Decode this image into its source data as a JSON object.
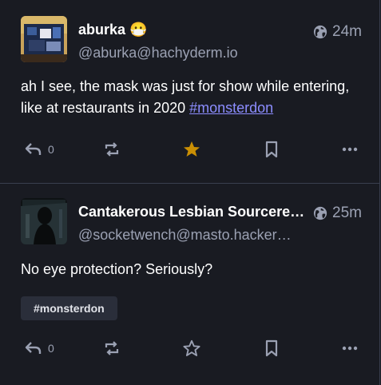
{
  "posts": [
    {
      "display_name": "aburka",
      "emoji": "😷",
      "handle": "@aburka@hachyderm.io",
      "time": "24m",
      "content_text": "ah I see, the mask was just for show while entering, like at restaurants in 2020 ",
      "hashtag": "#monsterdon",
      "reply_count": "0",
      "favourited": true
    },
    {
      "display_name": "Cantakerous Lesbian Sourcere…",
      "handle": "@socketwench@masto.hacker…",
      "time": "25m",
      "content_text": "No eye protection? Seriously?",
      "tag_chip": "#monsterdon",
      "reply_count": "0",
      "favourited": false
    }
  ],
  "colors": {
    "background": "#191b22",
    "muted_text": "#9ba1b3",
    "link": "#8c8dff",
    "favourite_active": "#ca8f04",
    "divider": "#393f4f"
  },
  "icons": [
    "globe-icon",
    "reply-icon",
    "boost-icon",
    "star-icon",
    "bookmark-icon",
    "more-icon"
  ]
}
